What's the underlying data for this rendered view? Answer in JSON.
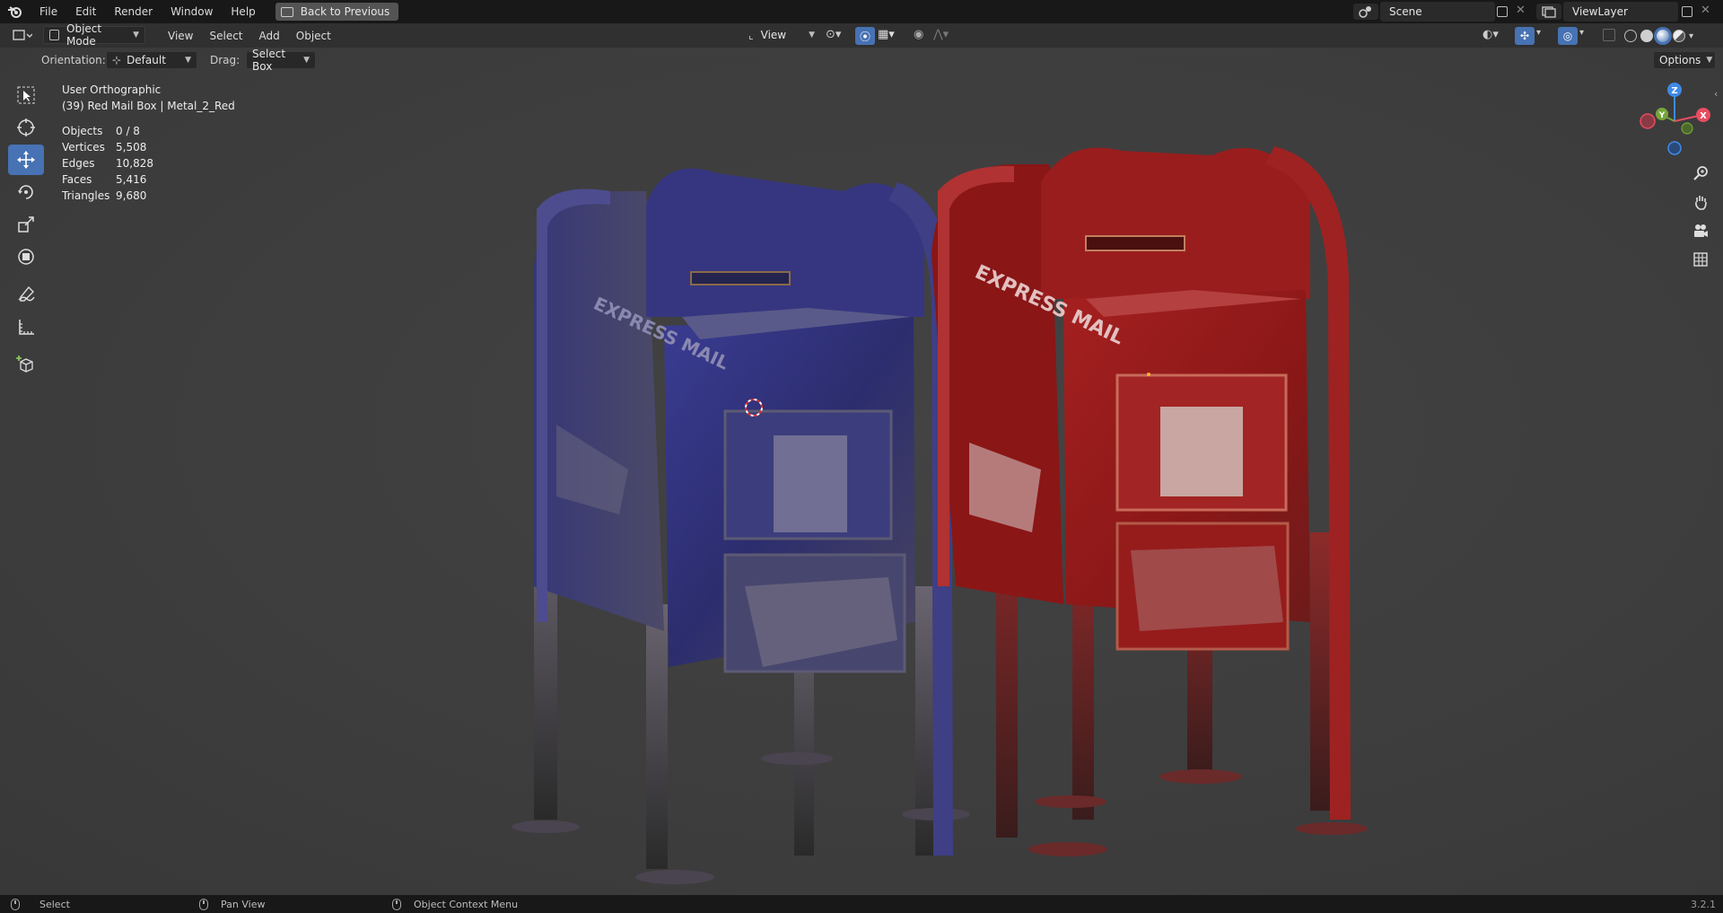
{
  "topbar": {
    "menus": [
      "File",
      "Edit",
      "Render",
      "Window",
      "Help"
    ],
    "back_button": "Back to Previous",
    "scene_name": "Scene",
    "view_layer": "ViewLayer"
  },
  "header": {
    "mode": "Object Mode",
    "menus": [
      "View",
      "Select",
      "Add",
      "Object"
    ],
    "transform_pivot": "View",
    "orientation_label": "Orientation:",
    "orientation_value": "Default",
    "drag_label": "Drag:",
    "drag_value": "Select Box",
    "options_label": "Options"
  },
  "viewport": {
    "view_name": "User Orthographic",
    "active_object": "(39) Red Mail Box | Metal_2_Red",
    "stats": [
      {
        "label": "Objects",
        "value": "0 / 8"
      },
      {
        "label": "Vertices",
        "value": "5,508"
      },
      {
        "label": "Edges",
        "value": "10,828"
      },
      {
        "label": "Faces",
        "value": "5,416"
      },
      {
        "label": "Triangles",
        "value": "9,680"
      }
    ],
    "axes": {
      "x": "X",
      "y": "Y",
      "z": "Z"
    },
    "mailbox_left_text": "EXPRESS MAIL",
    "mailbox_right_text": "EXPRESS MAIL"
  },
  "toolbar_tools": [
    "select-box",
    "cursor",
    "move",
    "rotate",
    "scale",
    "transform",
    "annotate",
    "measure",
    "add-cube"
  ],
  "statusbar": {
    "select": "Select",
    "pan": "Pan View",
    "context": "Object Context Menu",
    "version": "3.2.1"
  },
  "colors": {
    "accent": "#4772b3",
    "x_axis": "#e84d5f",
    "y_axis": "#76a53a",
    "z_axis": "#3e8ae6",
    "mailbox_blue": "#2e2f7a",
    "mailbox_red": "#8c1a1a"
  }
}
